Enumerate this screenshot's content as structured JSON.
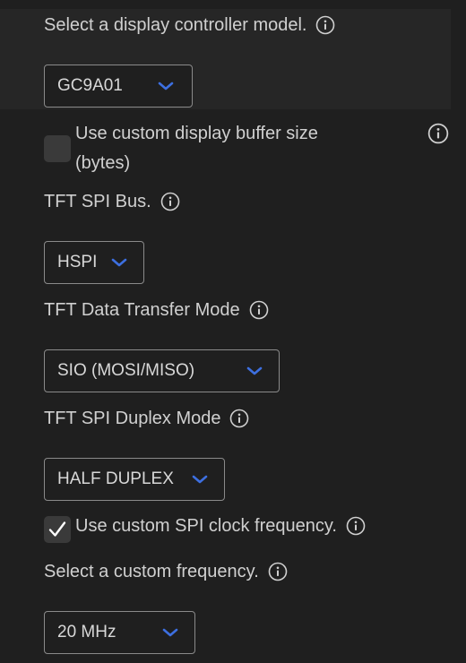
{
  "display_controller": {
    "label": "Select a display controller model.",
    "value": "GC9A01",
    "info_icon": "info-icon"
  },
  "custom_buffer": {
    "checked": false,
    "label_line1": "Use custom display buffer size",
    "label_line2": "(bytes)",
    "info_icon": "info-icon"
  },
  "spi_bus": {
    "label": "TFT SPI Bus.",
    "value": "HSPI",
    "info_icon": "info-icon"
  },
  "data_transfer_mode": {
    "label": "TFT Data Transfer Mode",
    "value": "SIO (MOSI/MISO)",
    "info_icon": "info-icon"
  },
  "duplex_mode": {
    "label": "TFT SPI Duplex Mode",
    "value": "HALF DUPLEX",
    "info_icon": "info-icon"
  },
  "custom_clock": {
    "checked": true,
    "label": "Use custom SPI clock frequency.",
    "info_icon": "info-icon"
  },
  "custom_frequency": {
    "label": "Select a custom frequency.",
    "value": "20 MHz",
    "info_icon": "info-icon"
  },
  "colors": {
    "background": "#1f1f1f",
    "highlight": "#262626",
    "chevron": "#3d6fe0",
    "border": "#8a8a8a",
    "text": "#d0d0d0"
  }
}
